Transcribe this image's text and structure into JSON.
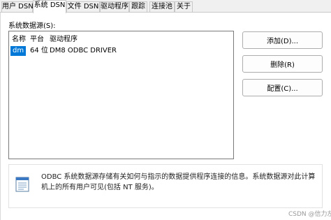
{
  "tabs": [
    {
      "label": "用户 DSN"
    },
    {
      "label": "系统 DSN"
    },
    {
      "label": "文件 DSN"
    },
    {
      "label": "驱动程序"
    },
    {
      "label": "跟踪"
    },
    {
      "label": "连接池"
    },
    {
      "label": "关于"
    }
  ],
  "active_tab": "系统 DSN",
  "list": {
    "label": "系统数据源(S):",
    "columns": [
      "名称",
      "平台",
      "驱动程序"
    ],
    "rows": [
      {
        "name": "dm",
        "platform": "64 位",
        "driver": "DM8 ODBC DRIVER"
      }
    ]
  },
  "buttons": {
    "add": "添加(D)...",
    "remove": "删除(R)",
    "configure": "配置(C)..."
  },
  "info": {
    "text": "ODBC 系统数据源存储有关如何与指示的数据提供程序连接的信息。系统数据源对此计算机上的所有用户可见(包括 NT 服务)。"
  },
  "watermark": "CSDN @信力左手",
  "colors": {
    "selection": "#0078d7",
    "panel": "#ffffff",
    "chrome": "#f0f0f0"
  }
}
